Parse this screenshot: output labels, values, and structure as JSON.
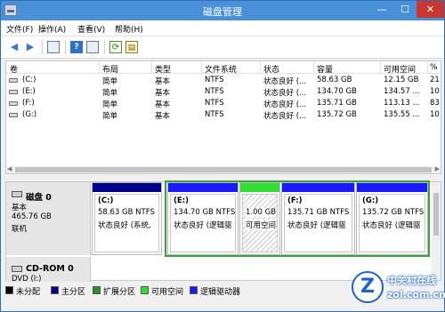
{
  "window": {
    "title": "磁盘管理",
    "controls": {
      "minimize": "—",
      "maximize": "☐",
      "close": "✕"
    }
  },
  "menu": [
    "文件(F)",
    "操作(A)",
    "查看(V)",
    "帮助(H)"
  ],
  "toolbar": {
    "help_label": "?",
    "refresh_label": "⟳",
    "props_label": "▤"
  },
  "volumes_table": {
    "columns": [
      "卷",
      "布局",
      "类型",
      "文件系统",
      "状态",
      "容量",
      "可用空间",
      "%"
    ],
    "rows": [
      [
        "(C:)",
        "简单",
        "基本",
        "NTFS",
        "状态良好 (...",
        "58.63 GB",
        "12.15 GB",
        "21"
      ],
      [
        "(E:)",
        "简单",
        "基本",
        "NTFS",
        "状态良好 (...",
        "134.70 GB",
        "134.57 ...",
        "10"
      ],
      [
        "(F:)",
        "简单",
        "基本",
        "NTFS",
        "状态良好 (...",
        "135.71 GB",
        "113.13 ...",
        "83"
      ],
      [
        "(G:)",
        "简单",
        "基本",
        "NTFS",
        "状态良好 (...",
        "135.72 GB",
        "135.55 ...",
        "10"
      ]
    ]
  },
  "disk0": {
    "name": "磁盘 0",
    "type": "基本",
    "size": "465.76 GB",
    "status": "联机",
    "partitions": [
      {
        "name": "(C:)",
        "size": "58.63 GB NTFS",
        "status": "状态良好 (系统,",
        "bar_color": "#00008b"
      },
      {
        "name": "(E:)",
        "size": "134.70 GB NTFS",
        "status": "状态良好 (逻辑驱",
        "bar_color": "#1a1aff"
      },
      {
        "name": "",
        "size": "1.00 GB",
        "status": "可用空间",
        "bar_color": "#33dd33"
      },
      {
        "name": "(F:)",
        "size": "135.71 GB NTFS",
        "status": "状态良好 (逻辑驱",
        "bar_color": "#1a1aff"
      },
      {
        "name": "(G:)",
        "size": "135.72 GB NTFS",
        "status": "状态良好 (逻辑驱",
        "bar_color": "#1a1aff"
      }
    ]
  },
  "cdrom": {
    "name": "CD-ROM 0",
    "drive": "DVD (I:)"
  },
  "legend": [
    {
      "label": "未分配",
      "color": "#000000"
    },
    {
      "label": "主分区",
      "color": "#00008b"
    },
    {
      "label": "扩展分区",
      "color": "#2e8b2e"
    },
    {
      "label": "可用空间",
      "color": "#33dd33"
    },
    {
      "label": "逻辑驱动器",
      "color": "#1a1aff"
    }
  ],
  "watermark": {
    "line1": "中关村在线",
    "line2": "zol.com.cn"
  }
}
